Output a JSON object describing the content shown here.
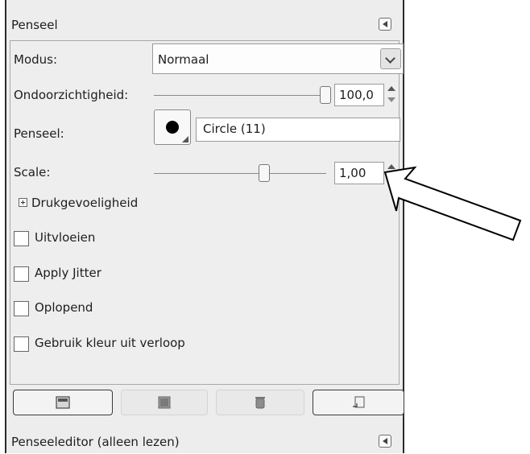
{
  "panel": {
    "title": "Penseel",
    "mode": {
      "label": "Modus:",
      "value": "Normaal"
    },
    "opacity": {
      "label": "Ondoorzichtigheid:",
      "value": "100,0",
      "fraction": 1.0
    },
    "brush": {
      "label": "Penseel:",
      "name": "Circle (11)"
    },
    "scale": {
      "label": "Scale:",
      "value": "1,00",
      "fraction": 0.65
    },
    "pressure": {
      "label": "Drukgevoeligheid"
    },
    "options": [
      {
        "label": "Uitvloeien",
        "checked": false
      },
      {
        "label": "Apply Jitter",
        "checked": false
      },
      {
        "label": "Oplopend",
        "checked": false
      },
      {
        "label": "Gebruik kleur uit verloop",
        "checked": false
      }
    ],
    "buttons": [
      {
        "icon": "save-icon",
        "enabled": true
      },
      {
        "icon": "restore-icon",
        "enabled": false
      },
      {
        "icon": "delete-icon",
        "enabled": false
      },
      {
        "icon": "reset-icon",
        "enabled": true
      }
    ]
  },
  "footer": {
    "title": "Penseeleditor (alleen lezen)"
  },
  "annotation": {
    "icon": "callout-arrow-icon"
  }
}
